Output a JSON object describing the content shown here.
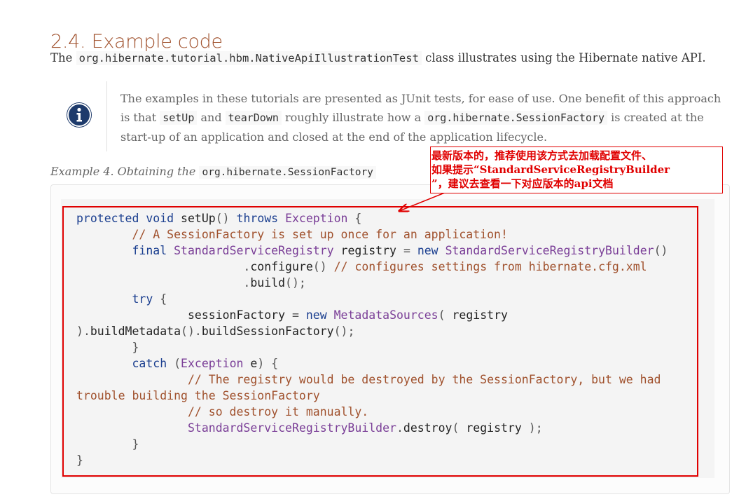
{
  "section": {
    "heading": "2.4. Example code",
    "intro": {
      "prefix": "The",
      "class_name": "org.hibernate.tutorial.hbm.NativeApiIllustrationTest",
      "suffix": "class illustrates using the Hibernate native API."
    }
  },
  "admonition": {
    "icon": "info-icon",
    "parts": [
      "The examples in these tutorials are presented as JUnit tests, for ease of use. One benefit of this approach is that",
      "setUp",
      "and",
      "tearDown",
      "roughly illustrate how a",
      "org.hibernate.SessionFactory",
      "is created at the start-up of an application and closed at the end of the application lifecycle."
    ]
  },
  "example": {
    "title_prefix": "Example 4. Obtaining the",
    "title_code": "org.hibernate.SessionFactory"
  },
  "code": {
    "kw_protected": "protected",
    "kw_void": "void",
    "m_setup": "setUp",
    "p_parens": "()",
    "kw_throws": "throws",
    "t_exception": "Exception",
    "p_lbrace": "{",
    "c_line1": "// A SessionFactory is set up once for an application!",
    "kw_final": "final",
    "t_ssr": "StandardServiceRegistry",
    "v_registry": "registry",
    "p_eq": "=",
    "kw_new": "new",
    "t_ssrb": "StandardServiceRegistryBuilder",
    "p_dot": ".",
    "m_configure": "configure",
    "c_line2": "// configures settings from hibernate.cfg.xml",
    "m_build": "build",
    "p_semi": ";",
    "kw_try": "try",
    "v_session_factory": "sessionFactory",
    "t_metadata_sources": "MetadataSources",
    "p_lparen": "(",
    "p_rparen": ")",
    "m_build_metadata": "buildMetadata",
    "m_build_session_factory": "buildSessionFactory",
    "p_rbrace": "}",
    "kw_catch": "catch",
    "v_e": "e",
    "c_line3a": "// The registry would be destroyed by the SessionFactory, but we had",
    "c_line3b": "trouble building the SessionFactory",
    "c_line4": "// so destroy it manually.",
    "m_destroy": "destroy"
  },
  "annotation": {
    "text": "最新版本的，推荐使用该方式去加载配置文件、\n如果提示“StandardServiceRegistryBuilder\n”，建议去查看一下对应版本的api文档",
    "color": "#e00000"
  },
  "colors": {
    "heading": "#a0512d",
    "keyword": "#1a3e8f",
    "type": "#7a3e97",
    "comment": "#a0512d",
    "info_icon": "#1d3a6b"
  }
}
